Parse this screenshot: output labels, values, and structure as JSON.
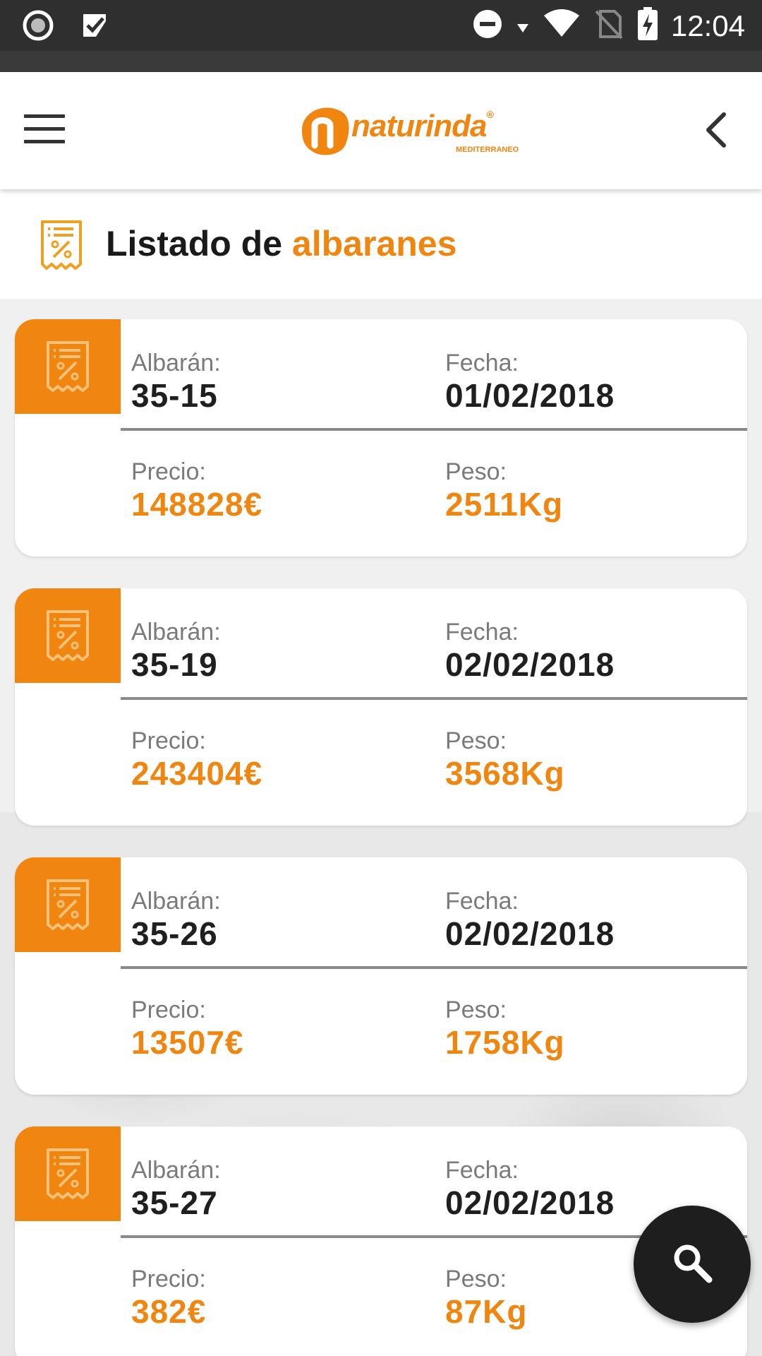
{
  "status_bar": {
    "time": "12:04",
    "icons": [
      "record-icon",
      "checklist-icon",
      "do-not-disturb-icon",
      "data-arrow-icon",
      "wifi-icon",
      "no-sim-icon",
      "battery-charging-icon"
    ]
  },
  "app_bar": {
    "logo_text": "naturinda",
    "logo_subtitle": "MEDITERRANEO",
    "menu_icon": "hamburger-menu-icon",
    "back_icon": "chevron-left-icon"
  },
  "page": {
    "title_prefix": "Listado de ",
    "title_accent": "albaranes",
    "title_icon": "receipt-percent-icon"
  },
  "colors": {
    "accent": "#f0860f",
    "status_bar": "#2f2f2f",
    "fab": "#1e1e1e"
  },
  "labels": {
    "albaran": "Albarán:",
    "fecha": "Fecha:",
    "precio": "Precio:",
    "peso": "Peso:"
  },
  "albaranes": [
    {
      "albaran": "35-15",
      "fecha": "01/02/2018",
      "precio": "148828€",
      "peso": "2511Kg"
    },
    {
      "albaran": "35-19",
      "fecha": "02/02/2018",
      "precio": "243404€",
      "peso": "3568Kg"
    },
    {
      "albaran": "35-26",
      "fecha": "02/02/2018",
      "precio": "13507€",
      "peso": "1758Kg"
    },
    {
      "albaran": "35-27",
      "fecha": "02/02/2018",
      "precio": "382€",
      "peso": "87Kg"
    }
  ],
  "fab": {
    "icon": "search-icon"
  }
}
